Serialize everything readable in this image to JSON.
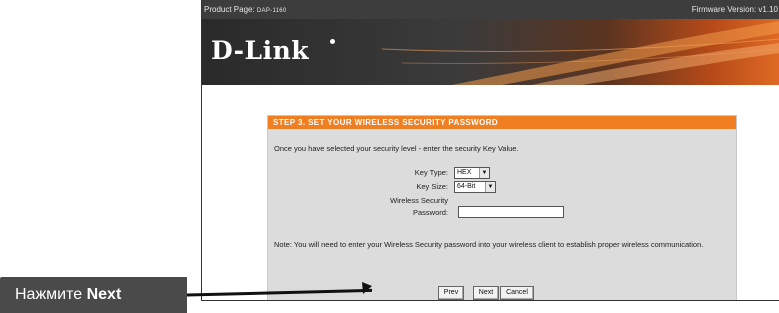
{
  "topbar": {
    "product_label": "Product Page: ",
    "product_model": "DAP-1160",
    "firmware": "Firmware Version: v1.10"
  },
  "header": {
    "logo": "D-Link",
    "colors": {
      "accent": "#f07f22",
      "dark": "#3d3d3d"
    }
  },
  "step": {
    "title": "STEP 3. SET YOUR WIRELESS SECURITY PASSWORD",
    "intro": "Once you have selected your security level - enter the security Key Value.",
    "key_type_label": "Key Type:",
    "key_type_value": "HEX",
    "key_size_label": "Key Size:",
    "key_size_value": "64-Bit",
    "password_label_1": "Wireless Security",
    "password_label_2": "Password:",
    "password_value": "",
    "note": "Note: You will need to enter your Wireless Security password into your wireless client to establish proper wireless communication.",
    "prev_label": "Prev",
    "next_label": "Next",
    "cancel_label": "Cancel"
  },
  "callout": {
    "prefix": "Нажмите ",
    "bold": "Next"
  },
  "icons": {
    "dropdown_arrow": "chevron-down-icon",
    "pointer_arrow": "arrow-right-icon"
  }
}
